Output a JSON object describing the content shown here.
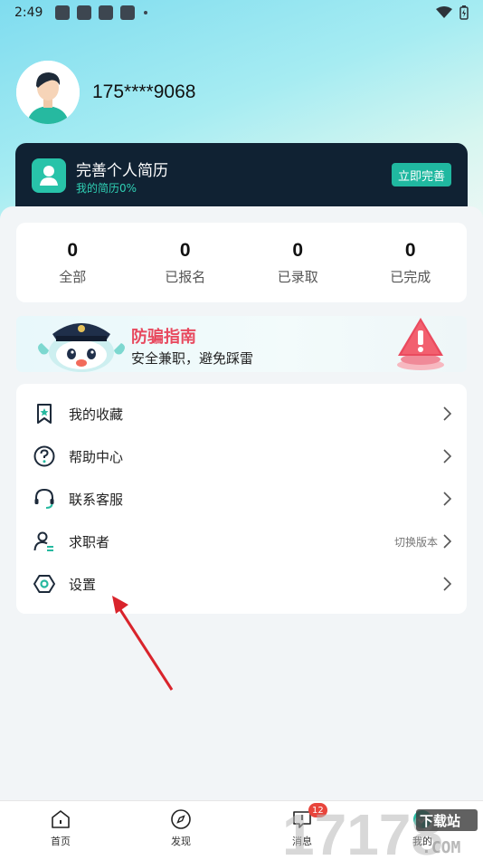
{
  "status_bar": {
    "time": "2:49"
  },
  "profile": {
    "phone": "175****9068"
  },
  "resume_card": {
    "title": "完善个人简历",
    "progress_text": "我的简历0%",
    "button_label": "立即完善",
    "accent_color": "#20b8a0"
  },
  "stats": [
    {
      "value": "0",
      "label": "全部"
    },
    {
      "value": "0",
      "label": "已报名"
    },
    {
      "value": "0",
      "label": "已录取"
    },
    {
      "value": "0",
      "label": "已完成"
    }
  ],
  "banner": {
    "title": "防骗指南",
    "subtitle": "安全兼职，避免踩雷"
  },
  "menu": [
    {
      "label": "我的收藏",
      "icon": "bookmark-star-icon"
    },
    {
      "label": "帮助中心",
      "icon": "help-circle-icon"
    },
    {
      "label": "联系客服",
      "icon": "headset-icon"
    },
    {
      "label": "求职者",
      "icon": "person-switch-icon",
      "extra": "切换版本"
    },
    {
      "label": "设置",
      "icon": "settings-hex-icon"
    }
  ],
  "tabbar": [
    {
      "label": "首页",
      "icon": "home-icon"
    },
    {
      "label": "发现",
      "icon": "compass-icon"
    },
    {
      "label": "消息",
      "icon": "message-icon",
      "badge": "12"
    },
    {
      "label": "我的",
      "icon": "profile-icon"
    }
  ],
  "watermark": {
    "digits": "17178",
    "site": "下载站",
    "domain": ".COM"
  }
}
